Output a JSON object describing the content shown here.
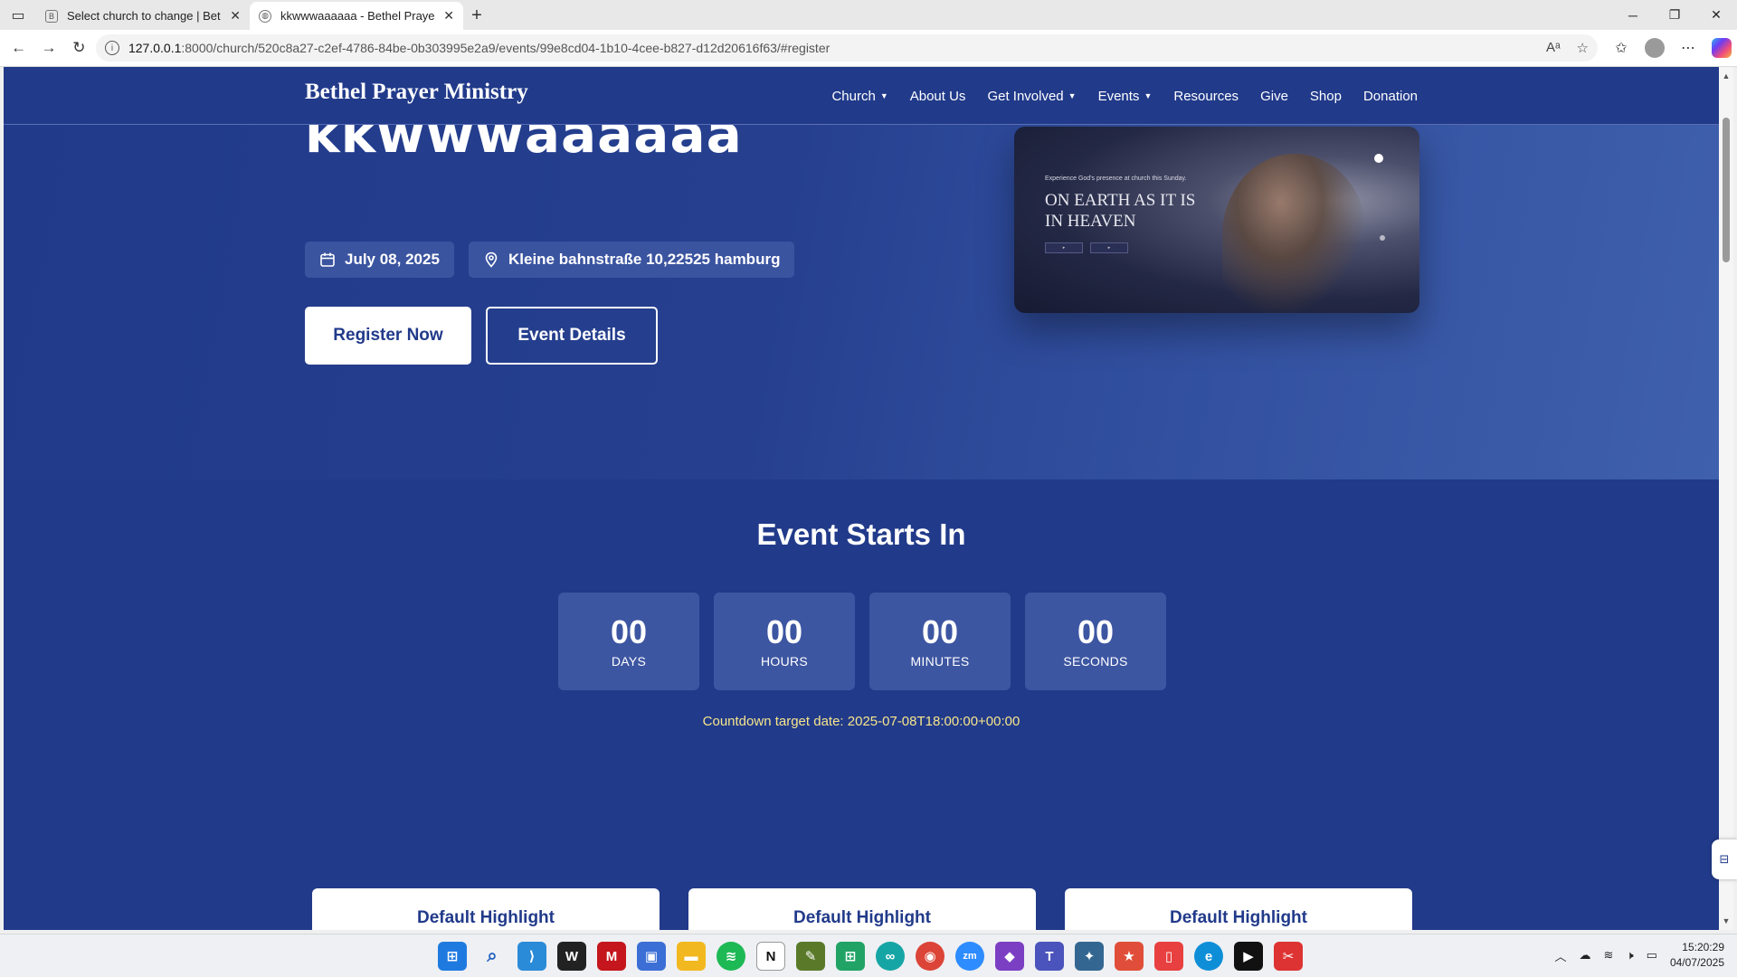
{
  "browser": {
    "tabs": [
      {
        "title": "Select church to change | Bethel P",
        "active": false
      },
      {
        "title": "kkwwwaaaaaa - Bethel Prayer Min",
        "active": true
      }
    ],
    "url_host": "127.0.0.1",
    "url_rest": ":8000/church/520c8a27-c2ef-4786-84be-0b303995e2a9/events/99e8cd04-1b10-4cee-b827-d12d20616f63/#register"
  },
  "site": {
    "brand": "Bethel Prayer Ministry",
    "nav": [
      "Church",
      "About Us",
      "Get Involved",
      "Events",
      "Resources",
      "Give",
      "Shop",
      "Donation"
    ]
  },
  "hero": {
    "title": "kkwwwaaaaaa",
    "date": "July 08, 2025",
    "location": "Kleine bahnstraße 10,22525 hamburg",
    "register_label": "Register Now",
    "details_label": "Event Details",
    "image": {
      "kicker": "Experience God's presence at church this Sunday.",
      "headline": "ON EARTH AS IT IS IN HEAVEN"
    }
  },
  "countdown": {
    "title": "Event Starts In",
    "units": [
      {
        "value": "00",
        "label": "DAYS"
      },
      {
        "value": "00",
        "label": "HOURS"
      },
      {
        "value": "00",
        "label": "MINUTES"
      },
      {
        "value": "00",
        "label": "SECONDS"
      }
    ],
    "target_text": "Countdown target date: 2025-07-08T18:00:00+00:00"
  },
  "highlights": [
    "Default Highlight",
    "Default Highlight",
    "Default Highlight"
  ],
  "taskbar": {
    "time": "15:20:29",
    "date": "04/07/2025"
  },
  "colors": {
    "page_bg": "#213a8a",
    "accent_text": "#f7e58c",
    "button_bg": "#ffffff"
  }
}
